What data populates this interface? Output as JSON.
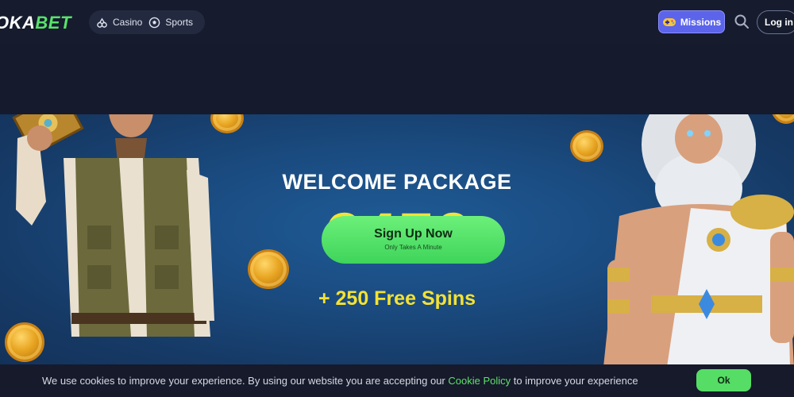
{
  "header": {
    "logo_text": "OKA",
    "logo_accent": "BET",
    "nav": [
      {
        "label": "Casino",
        "icon": "casino-icon"
      },
      {
        "label": "Sports",
        "icon": "soccer-ball-icon"
      }
    ],
    "missions_label": "Missions",
    "missions_icon": "gamepad-icon",
    "search_icon": "search-icon",
    "login_label": "Log in"
  },
  "hero": {
    "title": "WELCOME PACKAGE",
    "amount": "€450",
    "spins": "+ 250 Free Spins",
    "cta_label": "Sign Up Now",
    "cta_sub": "Only Takes A Minute"
  },
  "cookie": {
    "text_before": "We use cookies to improve your experience. By using our website you are accepting our ",
    "link_text": "Cookie Policy",
    "text_after": " to improve your experience",
    "ok_label": "Ok"
  },
  "colors": {
    "accent_green": "#58e36a",
    "missions_purple": "#5b64ea",
    "amount_yellow": "#f4e233",
    "hero_blue": "#1a4b80",
    "background_dark": "#151a2c"
  }
}
